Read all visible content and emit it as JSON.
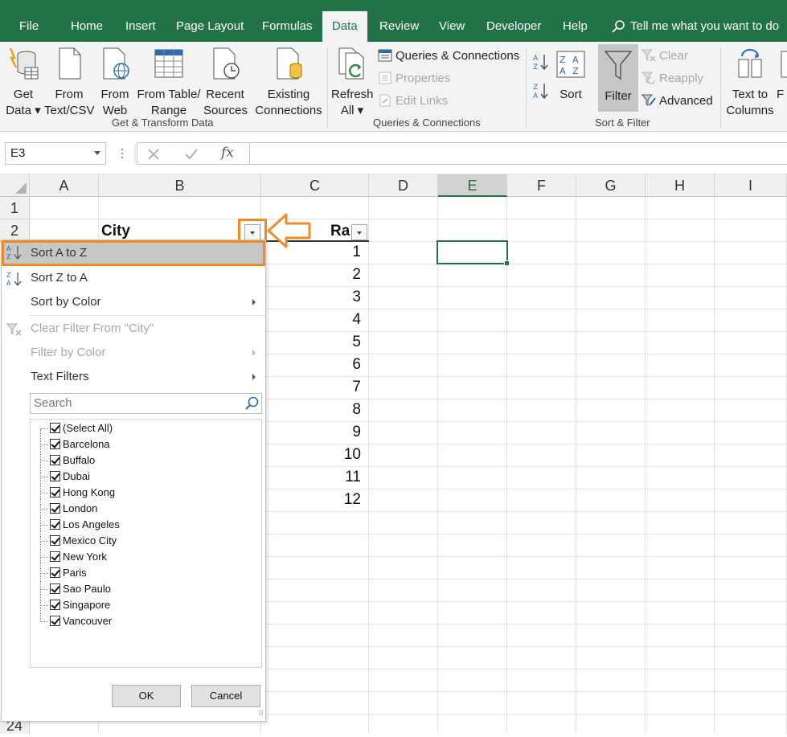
{
  "menu": {
    "tabs": [
      {
        "label": "File"
      },
      {
        "label": "Home"
      },
      {
        "label": "Insert"
      },
      {
        "label": "Page Layout"
      },
      {
        "label": "Formulas"
      },
      {
        "label": "Data"
      },
      {
        "label": "Review"
      },
      {
        "label": "View"
      },
      {
        "label": "Developer"
      },
      {
        "label": "Help"
      }
    ],
    "tell_me": "Tell me what you want to do"
  },
  "ribbon": {
    "get_data": {
      "line1": "Get",
      "line2": "Data ▾"
    },
    "from_text": {
      "line1": "From",
      "line2": "Text/CSV"
    },
    "from_web": {
      "line1": "From",
      "line2": "Web"
    },
    "from_table": {
      "line1": "From Table/",
      "line2": "Range"
    },
    "recent": {
      "line1": "Recent",
      "line2": "Sources"
    },
    "existing": {
      "line1": "Existing",
      "line2": "Connections"
    },
    "group_get": "Get & Transform Data",
    "refresh": {
      "line1": "Refresh",
      "line2": "All ▾"
    },
    "queries_connections": "Queries & Connections",
    "properties": "Properties",
    "edit_links": "Edit Links",
    "group_queries": "Queries & Connections",
    "sort": "Sort",
    "filter": "Filter",
    "clear": "Clear",
    "reapply": "Reapply",
    "advanced": "Advanced",
    "group_sort": "Sort & Filter",
    "text_to_columns": {
      "line1": "Text to",
      "line2": "Columns"
    },
    "partial": {
      "line1": "F"
    }
  },
  "formula_bar": {
    "name_box": "E3",
    "fx": "fx"
  },
  "grid": {
    "columns": [
      "A",
      "B",
      "C",
      "D",
      "E",
      "F",
      "G",
      "H",
      "I"
    ],
    "rows_top": [
      "1",
      "2"
    ],
    "row_bottom": "24",
    "header_city": "City",
    "header_rank": "Ra",
    "rank_values": [
      "1",
      "2",
      "3",
      "4",
      "5",
      "6",
      "7",
      "8",
      "9",
      "10",
      "11",
      "12"
    ]
  },
  "filter_menu": {
    "sort_az": "Sort A to Z",
    "sort_za": "Sort Z to A",
    "sort_by_color": "Sort by Color",
    "clear_filter": "Clear Filter From \"City\"",
    "filter_by_color": "Filter by Color",
    "text_filters": "Text Filters",
    "search_placeholder": "Search",
    "items": [
      "(Select All)",
      "Barcelona",
      "Buffalo",
      "Dubai",
      "Hong Kong",
      "London",
      "Los Angeles",
      "Mexico City",
      "New York",
      "Paris",
      "Sao Paulo",
      "Singapore",
      "Vancouver"
    ],
    "ok": "OK",
    "cancel": "Cancel"
  },
  "colors": {
    "excel_green": "#217346",
    "highlight_orange": "#f08a24"
  }
}
